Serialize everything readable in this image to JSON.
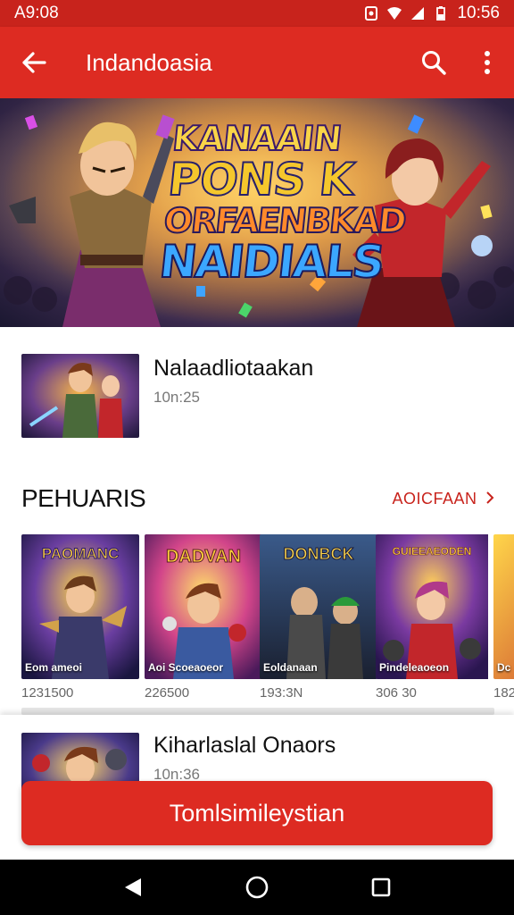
{
  "status_bar": {
    "time_left": "A9:08",
    "time_right": "10:56"
  },
  "app_bar": {
    "title": "Indandoasia",
    "back_icon": "arrow-left-icon",
    "search_icon": "search-icon",
    "more_icon": "more-vertical-icon"
  },
  "hero": {
    "title_lines": [
      "KANAAIN",
      "PONS K",
      "ORFAENBKAD",
      "NAIDIALS"
    ]
  },
  "featured": {
    "name": "Nalaadliotaakan",
    "subtitle": "10n:25"
  },
  "section": {
    "title": "PEHUARIS",
    "more_label": "AOICFAAN"
  },
  "cards": [
    {
      "poster_title": "PAOMANC",
      "poster_label": "Eom ameoi",
      "caption": "1231500"
    },
    {
      "poster_title": "DADVAN",
      "poster_label": "Aoi Scoeaoeor",
      "caption": "226500"
    },
    {
      "poster_title": "DONBCK",
      "poster_label": "Eoldanaan",
      "caption": "193:3N"
    },
    {
      "poster_title": "GUIEEAEODEN",
      "poster_label": "Pindeleaoeon",
      "caption": "306 30"
    },
    {
      "poster_title": "",
      "poster_label": "Dc",
      "caption": "182"
    }
  ],
  "second_item": {
    "name": "Kiharlaslal Onaors",
    "subtitle": "10n:36"
  },
  "cta": {
    "label": "Tomlsimileystian"
  },
  "colors": {
    "primary": "#dd2b22",
    "status": "#c8231c"
  }
}
